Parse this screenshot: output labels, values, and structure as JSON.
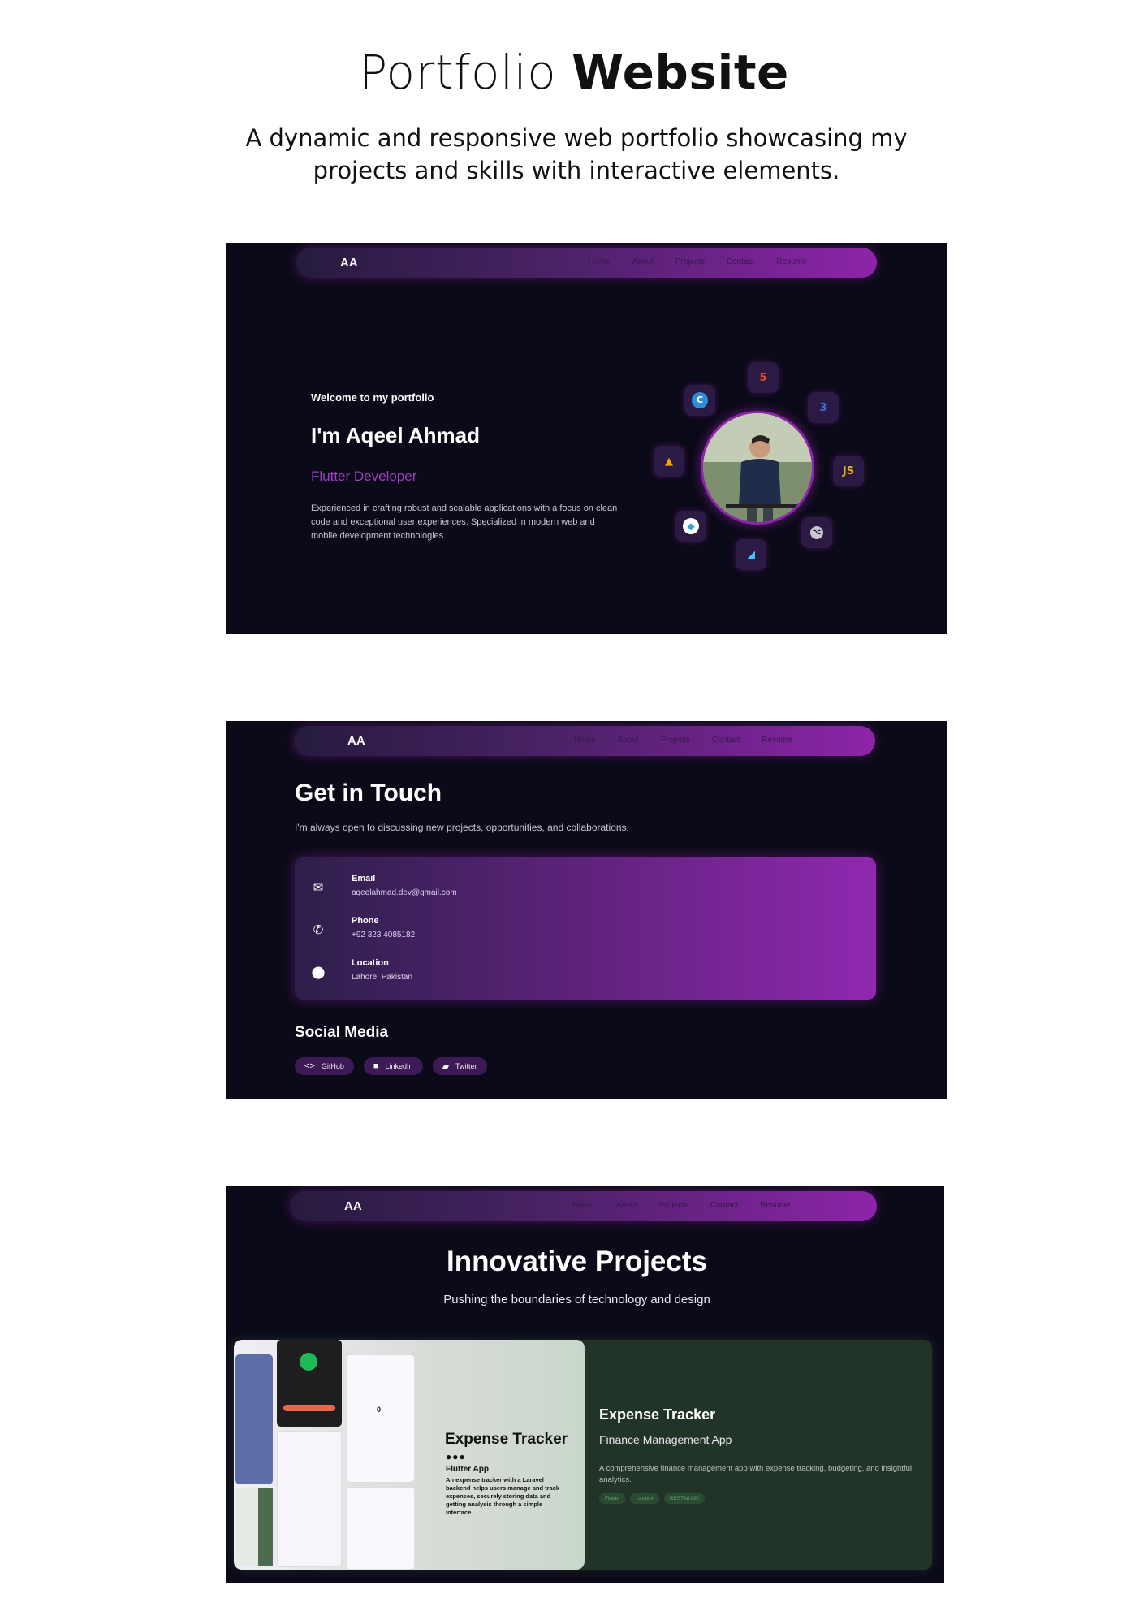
{
  "page": {
    "title_light": "Portfolio",
    "title_bold": "Website",
    "subtitle": "A dynamic and responsive web portfolio showcasing my projects and skills with interactive elements."
  },
  "nav": {
    "logo": "AA",
    "links": [
      "Home",
      "About",
      "Projects",
      "Contact",
      "Resume"
    ]
  },
  "hero": {
    "welcome": "Welcome to my portfolio",
    "name": "I'm Aqeel Ahmad",
    "role": "Flutter Developer",
    "description": "Experienced in crafting robust and scalable applications with a focus on clean code and exceptional user experiences. Specialized in modern web and mobile development technologies.",
    "tech_icons": [
      "html5-icon",
      "css3-icon",
      "javascript-icon",
      "github-icon",
      "flutter-icon",
      "dart-icon",
      "firebase-icon",
      "c-language-icon"
    ]
  },
  "contact": {
    "title": "Get in Touch",
    "subtitle": "I'm always open to discussing new projects, opportunities, and collaborations.",
    "items": [
      {
        "icon": "mail-icon",
        "label": "Email",
        "value": "aqeelahmad.dev@gmail.com"
      },
      {
        "icon": "phone-icon",
        "label": "Phone",
        "value": "+92 323 4085182"
      },
      {
        "icon": "location-pin-icon",
        "label": "Location",
        "value": "Lahore, Pakistan"
      }
    ],
    "social_title": "Social Media",
    "social": [
      {
        "icon": "code-icon",
        "label": "GitHub"
      },
      {
        "icon": "briefcase-icon",
        "label": "LinkedIn"
      },
      {
        "icon": "chat-icon",
        "label": "Twitter"
      }
    ]
  },
  "projects": {
    "title": "Innovative Projects",
    "subtitle": "Pushing the boundaries of technology and design",
    "card": {
      "image_title": "Expense Tracker",
      "image_dots": "●●●",
      "image_type": "Flutter App",
      "image_desc": "An expense tracker with a Laravel backend helps users manage and track expenses, securely storing data and getting analysis through a simple interface.",
      "name": "Expense Tracker",
      "kind": "Finance Management App",
      "description": "A comprehensive finance management app with expense tracking, budgeting, and insightful analytics.",
      "tags": [
        "Flutter",
        "Laravel",
        "RESTful API"
      ]
    }
  },
  "colors": {
    "background": "#0b0a18",
    "accent": "#8e24aa",
    "role_text": "#9c3ec4",
    "project_card": "#223427"
  }
}
